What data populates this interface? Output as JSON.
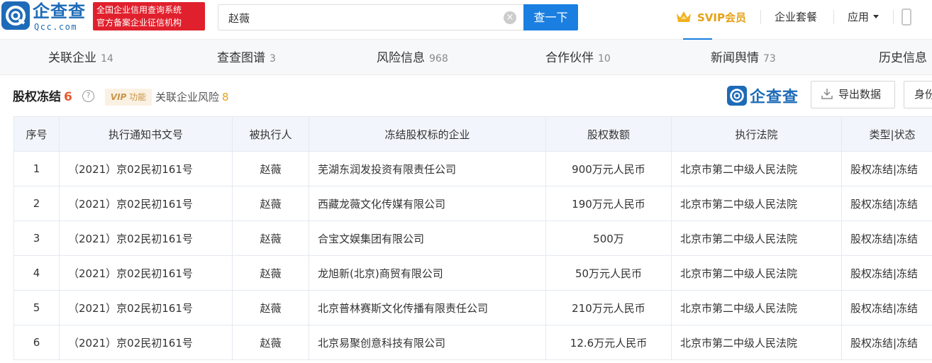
{
  "header": {
    "logo_cn": "企查查",
    "logo_en": "Qcc.com",
    "badge_line1": "全国企业信用查询系统",
    "badge_line2": "官方备案企业征信机构",
    "search_value": "赵薇",
    "clear_icon": "×",
    "search_button": "查一下",
    "svip_label": "SVIP会员",
    "nav_package": "企业套餐",
    "nav_apps": "应用",
    "brand_color": "#1a7fe0"
  },
  "tabs": [
    {
      "label": "关联企业",
      "count": "14"
    },
    {
      "label": "查查图谱",
      "count": "3"
    },
    {
      "label": "风险信息",
      "count": "968"
    },
    {
      "label": "合作伙伴",
      "count": "10"
    },
    {
      "label": "新闻舆情",
      "count": "73"
    },
    {
      "label": "历史信息",
      "count": ""
    }
  ],
  "section": {
    "title": "股权冻结",
    "count": "6",
    "help_icon": "?",
    "vip_badge_prefix": "VIP",
    "vip_badge_suffix": "功能",
    "risk_label": "关联企业风险",
    "risk_count": "8",
    "qcc_mini_text": "企查查",
    "export_label": "导出数据",
    "more_label": "身份"
  },
  "table": {
    "headers": [
      "序号",
      "执行通知书文号",
      "被执行人",
      "冻结股权标的企业",
      "股权数额",
      "执行法院",
      "类型|状态"
    ],
    "rows": [
      {
        "no": "1",
        "doc": "（2021）京02民初161号",
        "person": "赵薇",
        "company": "芜湖东润发投资有限责任公司",
        "amount": "900万元人民币",
        "court": "北京市第二中级人民法院",
        "status": "股权冻结|冻结"
      },
      {
        "no": "2",
        "doc": "（2021）京02民初161号",
        "person": "赵薇",
        "company": "西藏龙薇文化传媒有限公司",
        "amount": "190万元人民币",
        "court": "北京市第二中级人民法院",
        "status": "股权冻结|冻结"
      },
      {
        "no": "3",
        "doc": "（2021）京02民初161号",
        "person": "赵薇",
        "company": "合宝文娱集团有限公司",
        "amount": "500万",
        "court": "北京市第二中级人民法院",
        "status": "股权冻结|冻结"
      },
      {
        "no": "4",
        "doc": "（2021）京02民初161号",
        "person": "赵薇",
        "company": "龙旭新(北京)商贸有限公司",
        "amount": "50万元人民币",
        "court": "北京市第二中级人民法院",
        "status": "股权冻结|冻结"
      },
      {
        "no": "5",
        "doc": "（2021）京02民初161号",
        "person": "赵薇",
        "company": "北京普林赛斯文化传播有限责任公司",
        "amount": "210万元人民币",
        "court": "北京市第二中级人民法院",
        "status": "股权冻结|冻结"
      },
      {
        "no": "6",
        "doc": "（2021）京02民初161号",
        "person": "赵薇",
        "company": "北京易聚创意科技有限公司",
        "amount": "12.6万元人民币",
        "court": "北京市第二中级人民法院",
        "status": "股权冻结|冻结"
      }
    ]
  }
}
